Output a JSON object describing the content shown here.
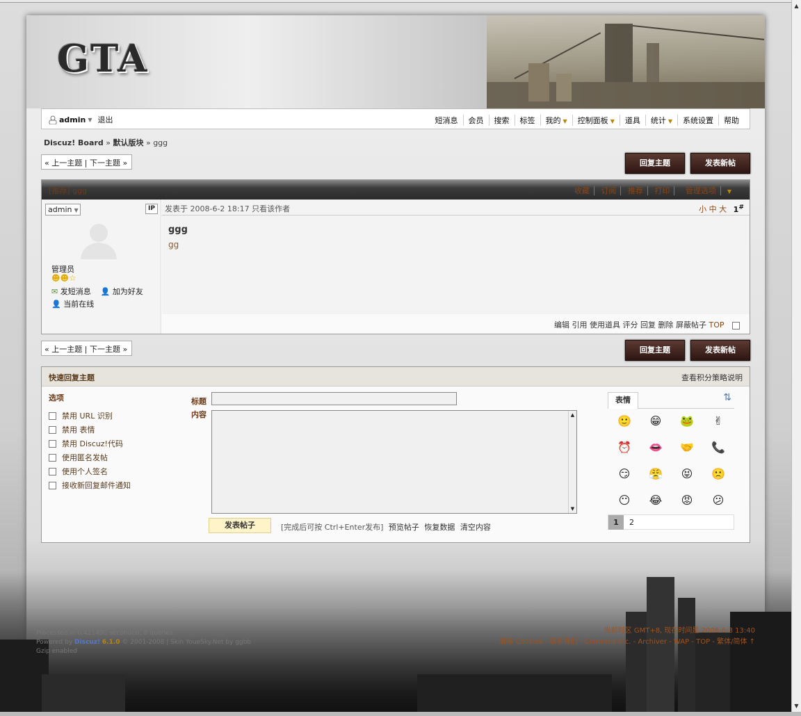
{
  "header": {
    "logo": "GTA"
  },
  "nav": {
    "user": "admin",
    "logout": "退出",
    "items": [
      {
        "label": "短消息",
        "caret": false
      },
      {
        "label": "会员",
        "caret": false
      },
      {
        "label": "搜索",
        "caret": false
      },
      {
        "label": "标签",
        "caret": false
      },
      {
        "label": "我的",
        "caret": true
      },
      {
        "label": "控制面板",
        "caret": true
      },
      {
        "label": "道具",
        "caret": false
      },
      {
        "label": "统计",
        "caret": true
      },
      {
        "label": "系统设置",
        "caret": false
      },
      {
        "label": "帮助",
        "caret": false
      }
    ]
  },
  "breadcrumb": {
    "board": "Discuz! Board",
    "sep1": "»",
    "forum": "默认版块",
    "sep2": "»",
    "thread": "ggg"
  },
  "pager": {
    "prev": "上一主题",
    "next": "下一主题",
    "left": "«",
    "right": "»",
    "divider": "|"
  },
  "buttons": {
    "reply": "回复主题",
    "new": "发表新帖"
  },
  "post": {
    "header_title": "[推荐] ggg",
    "tools": [
      "收藏",
      "订阅",
      "推荐",
      "打印",
      "管理选项"
    ],
    "author": "admin",
    "ip": "IP",
    "rank": "管理员",
    "send_msg": "发短消息",
    "add_friend": "加为好友",
    "online": "当前在线",
    "posted_at": "发表于  2008-6-2 18:17",
    "only_author": "只看该作者",
    "sizes": [
      "小",
      "中",
      "大"
    ],
    "floor": "1",
    "floor_sup": "#",
    "title": "ggg",
    "content": "gg",
    "ops": [
      "编辑",
      "引用",
      "使用道具",
      "评分",
      "回复",
      "删除",
      "屏蔽帖子"
    ],
    "top": "TOP"
  },
  "quick_reply": {
    "title": "快速回复主题",
    "policy": "查看积分策略说明",
    "options_title": "选项",
    "options": [
      "禁用 URL 识别",
      "禁用 表情",
      "禁用 Discuz!代码",
      "使用匿名发帖",
      "使用个人签名",
      "接收新回复邮件通知"
    ],
    "label_title": "标题",
    "label_content": "内容",
    "submit": "发表帖子",
    "hint_pre": "[完成后可按",
    "hint_key": "Ctrl+Enter",
    "hint_post": "发布]",
    "preview": "预览帖子",
    "restore": "恢复数据",
    "clear": "清空内容",
    "smilies_tab": "表情",
    "smilies": [
      "🙂",
      "😁",
      "🐸",
      "✌",
      "⏰",
      "👄",
      "🤝",
      "📞",
      "😏",
      "😤",
      "😝",
      "🙁",
      "😶",
      "😂",
      "😡",
      "😕"
    ],
    "page1": "1",
    "page2": "2"
  },
  "footer": {
    "processed": "Processed in 0.421490 second(s), 8 queries",
    "powered_pre": "Powered by",
    "discuz": "Discuz!",
    "version": "6.1.0",
    "powered_post": "© 2001-2008 | Skin YoueSky.Net by ggbb",
    "gzip": "Gzip enabled",
    "timezone": "当前时区 GMT+8, 现在时间是 2008-6-3 13:40",
    "links": "清除 Cookies - 联系我们 - Comsenz Inc. - Archiver - WAP - TOP - 繁体/简体 ↑"
  },
  "colors": {
    "accent": "#8b4513",
    "button_dark": "#3a1e18"
  }
}
